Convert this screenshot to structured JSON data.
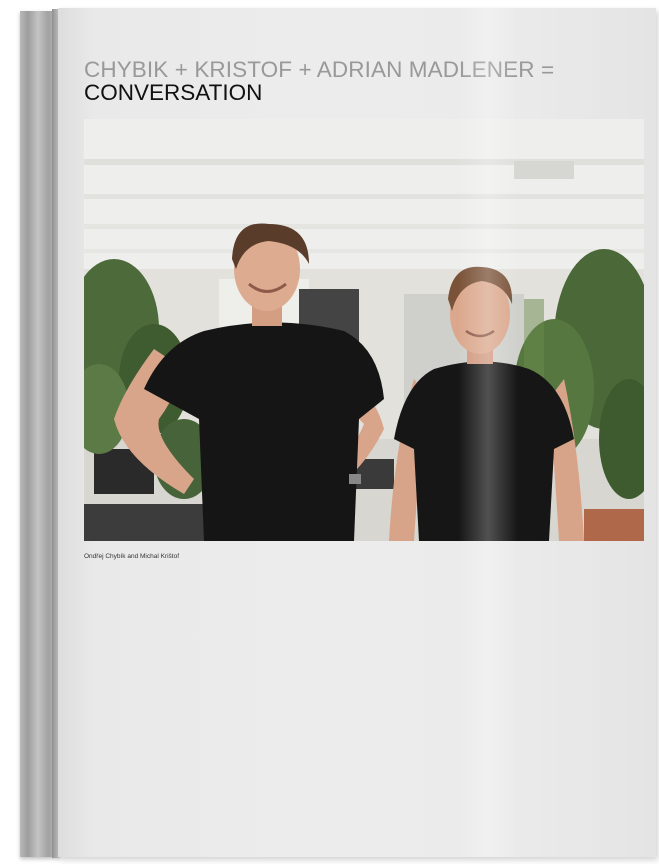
{
  "article": {
    "title_line1": "CHYBIK + KRISTOF + ADRIAN MADLENER =",
    "title_line2": "CONVERSATION",
    "photo_caption": "Ondřej Chybík and Michal Krištof"
  },
  "colors": {
    "cover": "#ececec",
    "title_grey": "#999999",
    "title_dark": "#111111",
    "tshirt": "#151515"
  }
}
